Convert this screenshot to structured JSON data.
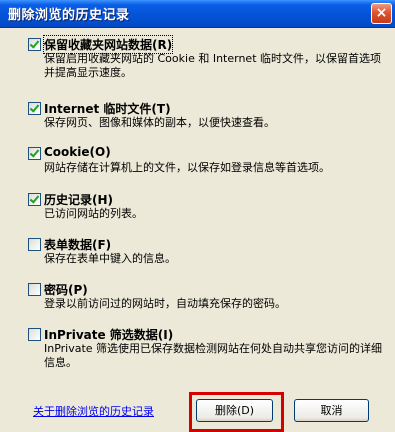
{
  "window": {
    "title": "删除浏览的历史记录",
    "close_glyph": "×"
  },
  "items": [
    {
      "label": "保留收藏夹网站数据(R)",
      "checked": true,
      "focused": true,
      "description": "保留启用收藏夹网站的 Cookie 和 Internet 临时文件，以保留首选项并提高显示速度。"
    },
    {
      "label": "Internet 临时文件(T)",
      "checked": true,
      "focused": false,
      "description": "保存网页、图像和媒体的副本，以便快速查看。"
    },
    {
      "label": "Cookie(O)",
      "checked": true,
      "focused": false,
      "description": "网站存储在计算机上的文件，以保存如登录信息等首选项。"
    },
    {
      "label": "历史记录(H)",
      "checked": true,
      "focused": false,
      "description": "已访问网站的列表。"
    },
    {
      "label": "表单数据(F)",
      "checked": false,
      "focused": false,
      "description": "保存在表单中键入的信息。"
    },
    {
      "label": "密码(P)",
      "checked": false,
      "focused": false,
      "description": "登录以前访问过的网站时，自动填充保存的密码。"
    },
    {
      "label": "InPrivate 筛选数据(I)",
      "checked": false,
      "focused": false,
      "description": "InPrivate 筛选使用已保存数据检测网站在何处自动共享您访问的详细信息。"
    }
  ],
  "footer": {
    "help_link": "关于删除浏览的历史记录",
    "delete_label": "删除(D)",
    "cancel_label": "取消"
  },
  "colors": {
    "title_bar": "#0453d6",
    "dialog_bg": "#ece9d8",
    "highlight": "#d50000",
    "check": "#21a121",
    "link": "#0000ee"
  }
}
